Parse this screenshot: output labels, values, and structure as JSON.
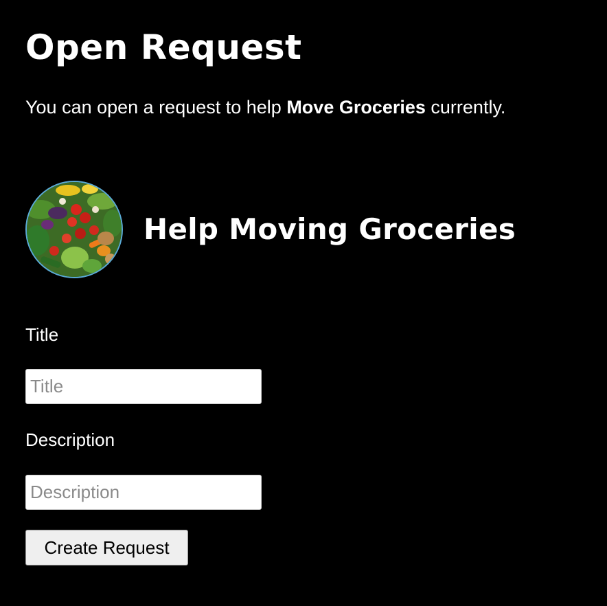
{
  "page": {
    "title": "Open Request",
    "intro_prefix": "You can open a request to help ",
    "intro_highlight": "Move Groceries",
    "intro_suffix": " currently."
  },
  "service": {
    "name": "Help Moving Groceries",
    "image": "groceries-photo",
    "ring_color": "#5aa9d6"
  },
  "form": {
    "title_label": "Title",
    "title_placeholder": "Title",
    "title_value": "",
    "description_label": "Description",
    "description_placeholder": "Description",
    "description_value": "",
    "submit_label": "Create Request"
  },
  "colors": {
    "background": "#000000",
    "text": "#ffffff",
    "button_bg": "#efefef"
  }
}
